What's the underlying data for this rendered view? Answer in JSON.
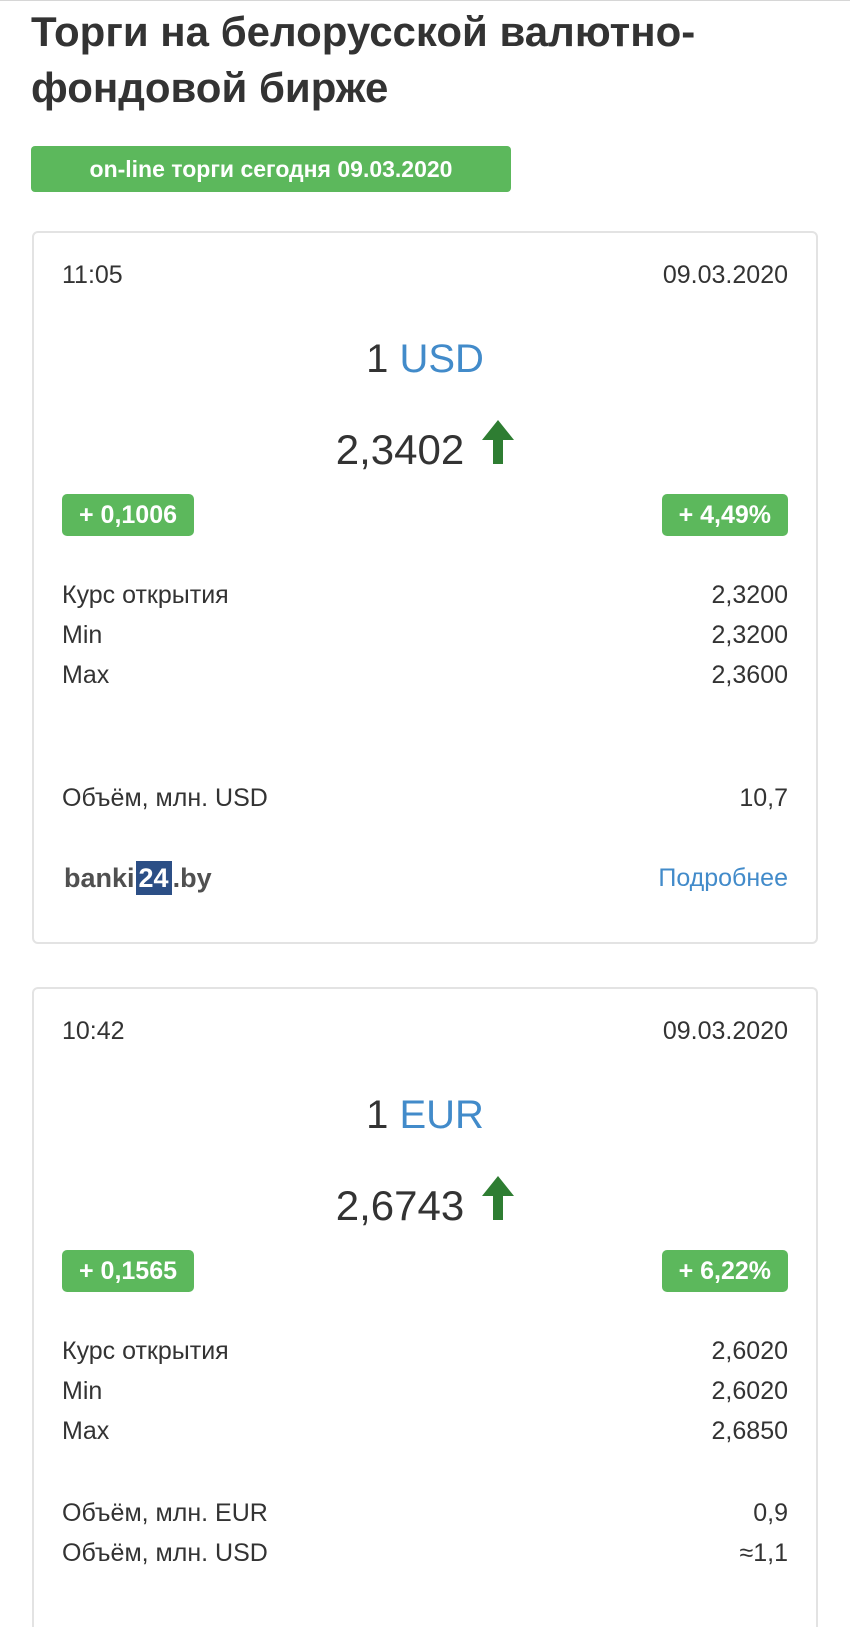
{
  "page": {
    "title": "Торги на белорусской валютно-фондовой бирже",
    "online_badge": "on-line торги сегодня 09.03.2020",
    "accent_color": "#5cb85c",
    "link_color": "#428bca"
  },
  "cards": [
    {
      "time": "11:05",
      "date": "09.03.2020",
      "amount": "1",
      "currency": "USD",
      "rate": "2,3402",
      "trend_icon": "arrow-up-icon",
      "change_abs": "+ 0,1006",
      "change_pct": "+ 4,49%",
      "rows": [
        {
          "label": "Курс открытия",
          "value": "2,3200"
        },
        {
          "label": "Min",
          "value": "2,3200"
        },
        {
          "label": "Max",
          "value": "2,3600"
        }
      ],
      "volumes": [
        {
          "label": "Объём, млн. USD",
          "value": "10,7"
        }
      ],
      "logo": {
        "part1": "banki",
        "part2": "24",
        "part3": ".by"
      },
      "more_link": "Подробнее"
    },
    {
      "time": "10:42",
      "date": "09.03.2020",
      "amount": "1",
      "currency": "EUR",
      "rate": "2,6743",
      "trend_icon": "arrow-up-icon",
      "change_abs": "+ 0,1565",
      "change_pct": "+ 6,22%",
      "rows": [
        {
          "label": "Курс открытия",
          "value": "2,6020"
        },
        {
          "label": "Min",
          "value": "2,6020"
        },
        {
          "label": "Max",
          "value": "2,6850"
        }
      ],
      "volumes": [
        {
          "label": "Объём, млн. EUR",
          "value": "0,9"
        },
        {
          "label": "Объём, млн. USD",
          "value": "≈1,1"
        }
      ]
    }
  ]
}
